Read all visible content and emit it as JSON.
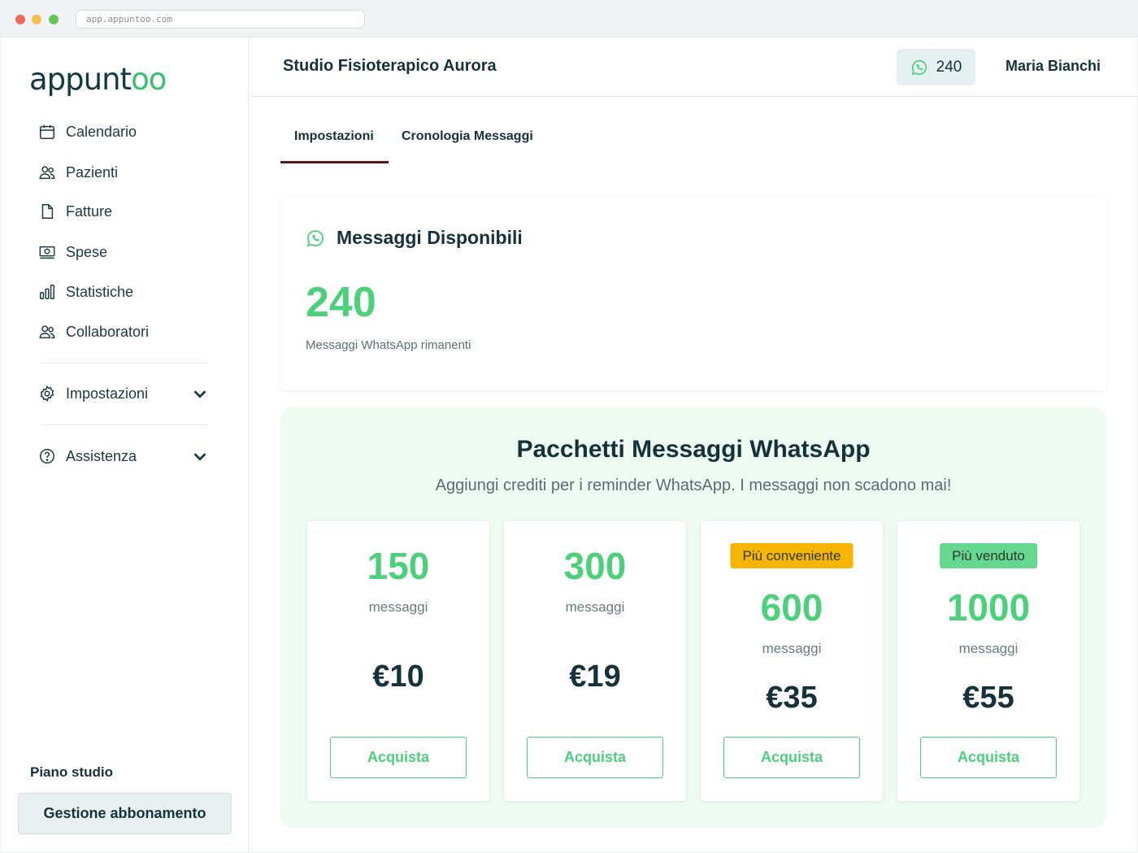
{
  "browser": {
    "url": "app.appuntoo.com"
  },
  "brand": {
    "logo_prefix": "appunt",
    "logo_oo": "oo"
  },
  "sidebar": {
    "items": [
      {
        "label": "Calendario",
        "icon": "calendar-icon"
      },
      {
        "label": "Pazienti",
        "icon": "users-icon"
      },
      {
        "label": "Fatture",
        "icon": "document-icon"
      },
      {
        "label": "Spese",
        "icon": "money-icon"
      },
      {
        "label": "Statistiche",
        "icon": "bar-chart-icon"
      },
      {
        "label": "Collaboratori",
        "icon": "users-icon"
      }
    ],
    "settings_label": "Impostazioni",
    "support_label": "Assistenza",
    "plan_label": "Piano studio",
    "plan_button": "Gestione abbonamento"
  },
  "header": {
    "studio_name": "Studio Fisioterapico Aurora",
    "credits": "240",
    "user_name": "Maria Bianchi"
  },
  "tabs": [
    {
      "label": "Impostazioni",
      "active": true
    },
    {
      "label": "Cronologia Messaggi",
      "active": false
    }
  ],
  "available": {
    "title": "Messaggi Disponibili",
    "count": "240",
    "subtitle": "Messaggi WhatsApp rimanenti"
  },
  "packages": {
    "title": "Pacchetti Messaggi WhatsApp",
    "subtitle": "Aggiungi crediti per i reminder WhatsApp. I messaggi non scadono mai!",
    "items": [
      {
        "count": "150",
        "unit": "messaggi",
        "price": "€10",
        "badge": "",
        "button": "Acquista"
      },
      {
        "count": "300",
        "unit": "messaggi",
        "price": "€19",
        "badge": "",
        "button": "Acquista"
      },
      {
        "count": "600",
        "unit": "messaggi",
        "price": "€35",
        "badge": "Più conveniente",
        "button": "Acquista"
      },
      {
        "count": "1000",
        "unit": "messaggi",
        "price": "€55",
        "badge": "Più venduto",
        "button": "Acquista"
      }
    ]
  },
  "colors": {
    "accent_green": "#4cd07c",
    "dark_text": "#15323a",
    "tab_underline": "#5a1a14",
    "badge_orange": "#f7b500",
    "badge_green": "#65d78e"
  }
}
